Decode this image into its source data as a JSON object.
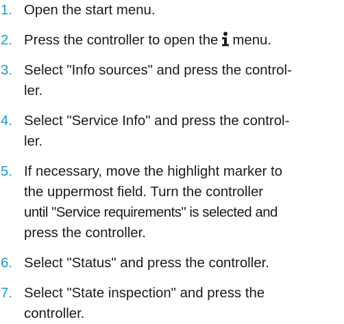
{
  "steps": [
    {
      "number": "1.",
      "text": "Open the start menu."
    },
    {
      "number": "2.",
      "text_before": "Press the controller to open the",
      "icon": "info-icon",
      "text_after": "menu."
    },
    {
      "number": "3.",
      "lines": [
        "Select \"Info sources\" and press the control-",
        "ler."
      ]
    },
    {
      "number": "4.",
      "lines": [
        "Select \"Service Info\" and press the control-",
        "ler."
      ]
    },
    {
      "number": "5.",
      "lines": [
        "If necessary, move the highlight marker to",
        "the uppermost field. Turn the controller",
        "until \"Service requirements\" is selected and",
        "press the controller."
      ]
    },
    {
      "number": "6.",
      "text": "Select \"Status\" and press the controller."
    },
    {
      "number": "7.",
      "lines": [
        "Select \"State inspection\" and press the",
        "controller."
      ]
    }
  ],
  "colors": {
    "number": "#2196d3",
    "text": "#1a1a1a"
  }
}
